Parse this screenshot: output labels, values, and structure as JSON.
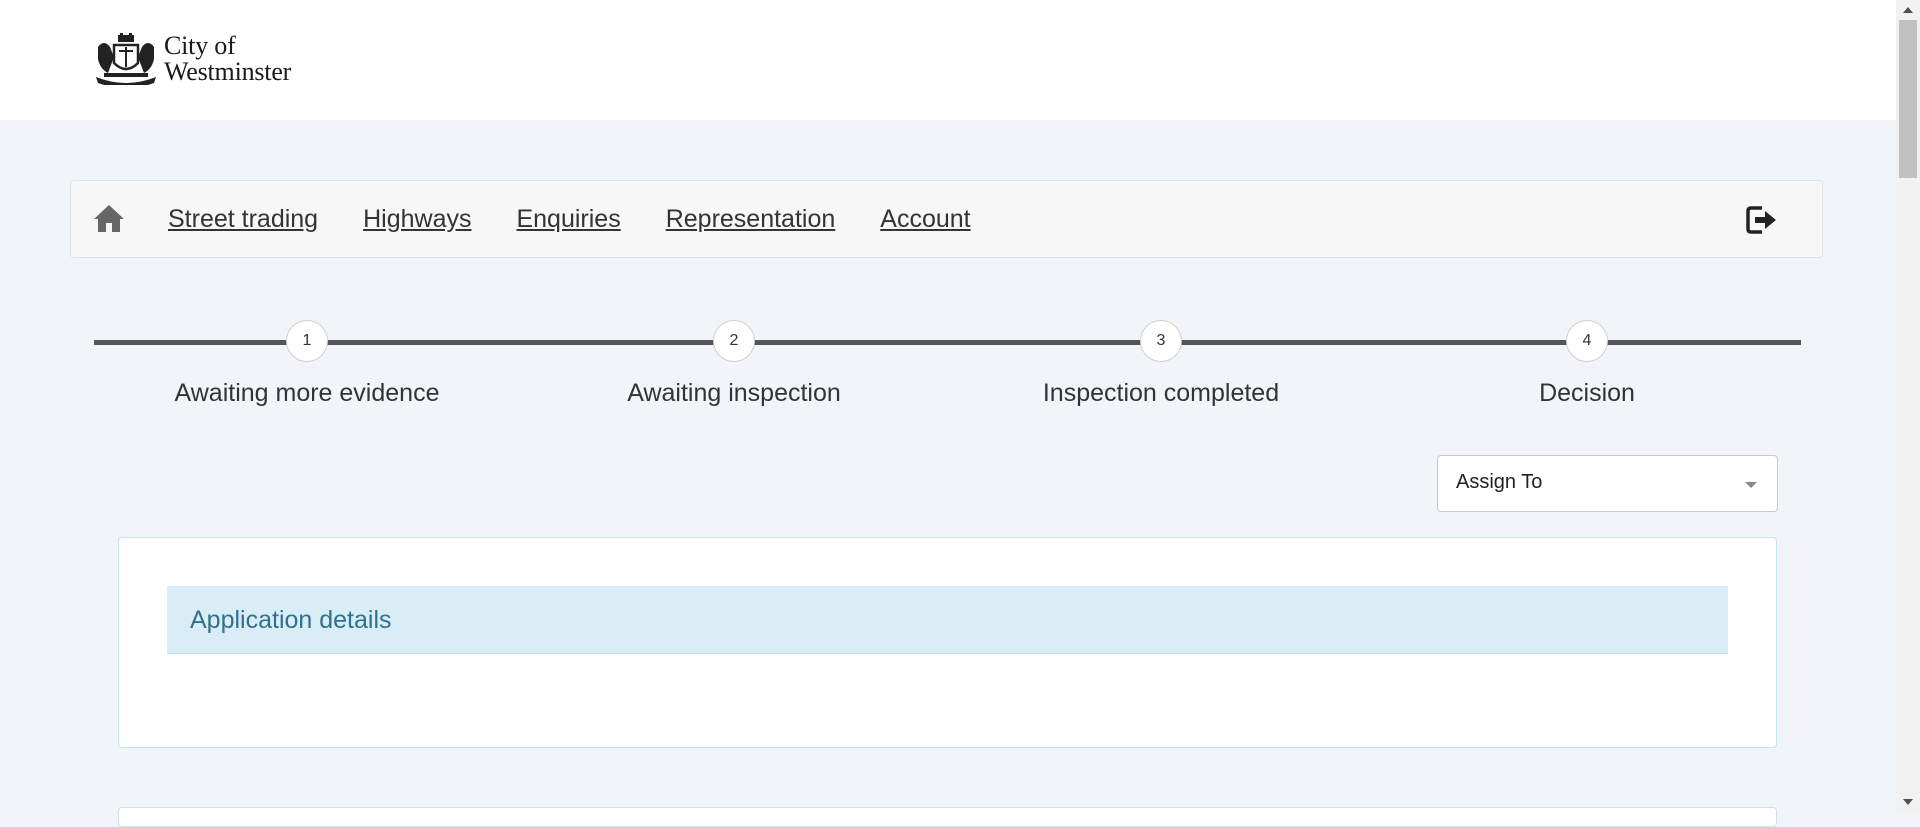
{
  "header": {
    "logo_line1": "City of",
    "logo_line2": "Westminster",
    "logo_icon": "coat-of-arms"
  },
  "nav": {
    "home_icon": "home-icon",
    "links": [
      "Street trading",
      "Highways",
      "Enquiries",
      "Representation",
      "Account"
    ],
    "logout_icon": "logout-icon"
  },
  "stepper": {
    "steps": [
      {
        "number": "1",
        "label": "Awaiting more evidence"
      },
      {
        "number": "2",
        "label": "Awaiting inspection"
      },
      {
        "number": "3",
        "label": "Inspection completed"
      },
      {
        "number": "4",
        "label": "Decision"
      }
    ]
  },
  "assign": {
    "selected": "Assign To"
  },
  "panel": {
    "title": "Application details"
  },
  "colors": {
    "page_bg": "#f1f5f9",
    "panel_heading_bg": "#d9edf6",
    "panel_title": "#31708f",
    "step_line": "#555555"
  }
}
